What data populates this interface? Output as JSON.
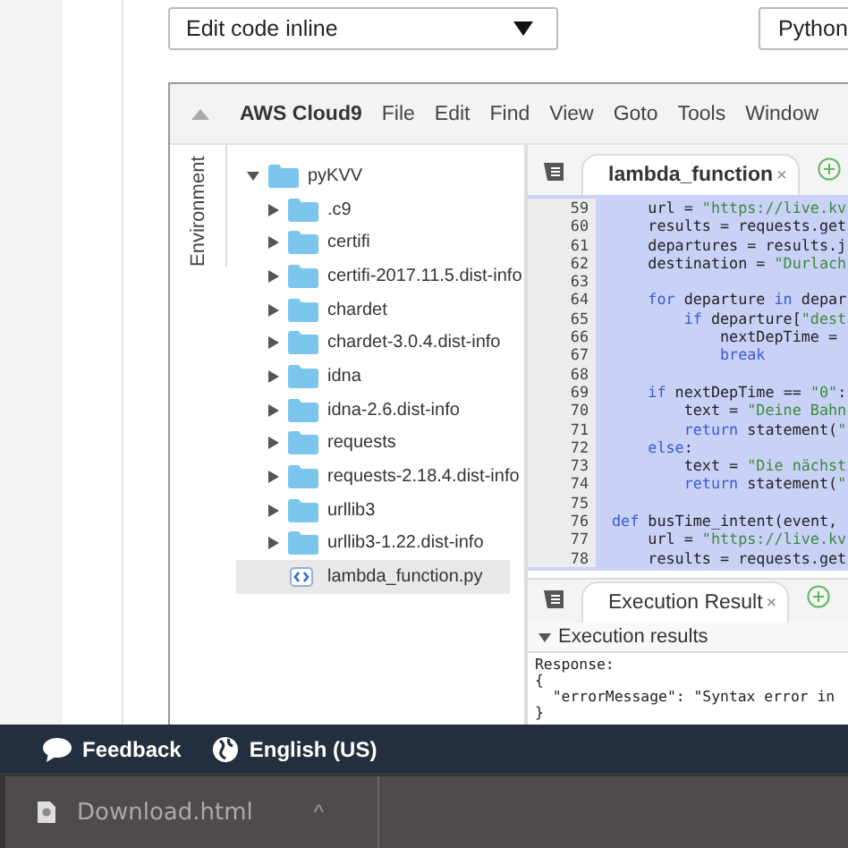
{
  "controls": {
    "mode_dropdown": "Edit code inline",
    "runtime_dropdown": "Python"
  },
  "ide": {
    "menu": [
      "AWS Cloud9",
      "File",
      "Edit",
      "Find",
      "View",
      "Goto",
      "Tools",
      "Window"
    ],
    "side_tab": "Environment",
    "tree": {
      "label": "pyKVV",
      "expanded": true,
      "children": [
        {
          "label": ".c9",
          "kind": "folder",
          "expanded": false
        },
        {
          "label": "certifi",
          "kind": "folder",
          "expanded": false
        },
        {
          "label": "certifi-2017.11.5.dist-info",
          "kind": "folder",
          "expanded": false
        },
        {
          "label": "chardet",
          "kind": "folder",
          "expanded": false
        },
        {
          "label": "chardet-3.0.4.dist-info",
          "kind": "folder",
          "expanded": false
        },
        {
          "label": "idna",
          "kind": "folder",
          "expanded": false
        },
        {
          "label": "idna-2.6.dist-info",
          "kind": "folder",
          "expanded": false
        },
        {
          "label": "requests",
          "kind": "folder",
          "expanded": false
        },
        {
          "label": "requests-2.18.4.dist-info",
          "kind": "folder",
          "expanded": false
        },
        {
          "label": "urllib3",
          "kind": "folder",
          "expanded": false
        },
        {
          "label": "urllib3-1.22.dist-info",
          "kind": "folder",
          "expanded": false
        },
        {
          "label": "lambda_function.py",
          "kind": "file",
          "selected": true
        }
      ]
    },
    "editor_tab": {
      "label": "lambda_function",
      "close": "×"
    },
    "code": [
      {
        "n": "59",
        "tokens": [
          {
            "t": "    url = ",
            "kind": "plain"
          },
          {
            "t": "\"https://live.kv",
            "kind": "string"
          }
        ]
      },
      {
        "n": "60",
        "tokens": [
          {
            "t": "    results = requests.get",
            "kind": "plain"
          }
        ]
      },
      {
        "n": "61",
        "tokens": [
          {
            "t": "    departures = results.j",
            "kind": "plain"
          }
        ]
      },
      {
        "n": "62",
        "tokens": [
          {
            "t": "    destination = ",
            "kind": "plain"
          },
          {
            "t": "\"Durlach",
            "kind": "string"
          }
        ]
      },
      {
        "n": "63"
      },
      {
        "n": "64",
        "tokens": [
          {
            "t": "    for",
            "kind": "keyword"
          },
          {
            "t": " departure ",
            "kind": "plain"
          },
          {
            "t": "in",
            "kind": "keyword"
          },
          {
            "t": " depar",
            "kind": "plain"
          }
        ]
      },
      {
        "n": "65",
        "tokens": [
          {
            "t": "        if",
            "kind": "keyword"
          },
          {
            "t": " departure[",
            "kind": "plain"
          },
          {
            "t": "\"dest",
            "kind": "string"
          }
        ]
      },
      {
        "n": "66",
        "tokens": [
          {
            "t": "            nextDepTime =",
            "kind": "plain"
          }
        ]
      },
      {
        "n": "67",
        "tokens": [
          {
            "t": "            break",
            "kind": "keyword"
          }
        ]
      },
      {
        "n": "68"
      },
      {
        "n": "69",
        "tokens": [
          {
            "t": "    if",
            "kind": "keyword"
          },
          {
            "t": " nextDepTime == ",
            "kind": "plain"
          },
          {
            "t": "\"0\"",
            "kind": "string"
          },
          {
            "t": ":",
            "kind": "plain"
          }
        ]
      },
      {
        "n": "70",
        "tokens": [
          {
            "t": "        text = ",
            "kind": "plain"
          },
          {
            "t": "\"Deine Bahn",
            "kind": "string"
          }
        ]
      },
      {
        "n": "71",
        "tokens": [
          {
            "t": "        return",
            "kind": "keyword"
          },
          {
            "t": " statement(",
            "kind": "plain"
          },
          {
            "t": "\"",
            "kind": "string"
          }
        ]
      },
      {
        "n": "72",
        "tokens": [
          {
            "t": "    else",
            "kind": "keyword"
          },
          {
            "t": ":",
            "kind": "plain"
          }
        ]
      },
      {
        "n": "73",
        "tokens": [
          {
            "t": "        text = ",
            "kind": "plain"
          },
          {
            "t": "\"Die nächst",
            "kind": "string"
          }
        ]
      },
      {
        "n": "74",
        "tokens": [
          {
            "t": "        return",
            "kind": "keyword"
          },
          {
            "t": " statement(",
            "kind": "plain"
          },
          {
            "t": "\"",
            "kind": "string"
          }
        ]
      },
      {
        "n": "75"
      },
      {
        "n": "76",
        "tokens": [
          {
            "t": "def",
            "kind": "keyword"
          },
          {
            "t": " busTime_intent(event,",
            "kind": "plain"
          }
        ]
      },
      {
        "n": "77",
        "tokens": [
          {
            "t": "    url = ",
            "kind": "plain"
          },
          {
            "t": "\"https://live.kv",
            "kind": "string"
          }
        ]
      },
      {
        "n": "78",
        "tokens": [
          {
            "t": "    results = requests.get",
            "kind": "plain"
          }
        ]
      }
    ],
    "result_tab": {
      "label": "Execution Result",
      "close": "×"
    },
    "results_header": {
      "label": "Execution results",
      "expanded": true
    },
    "output": [
      "Response:",
      "{",
      "  \"errorMessage\": \"Syntax error in",
      "}"
    ]
  },
  "footer": {
    "feedback": "Feedback",
    "language": "English (US)"
  },
  "downloads": {
    "file": "Download.html",
    "caret": "^"
  }
}
